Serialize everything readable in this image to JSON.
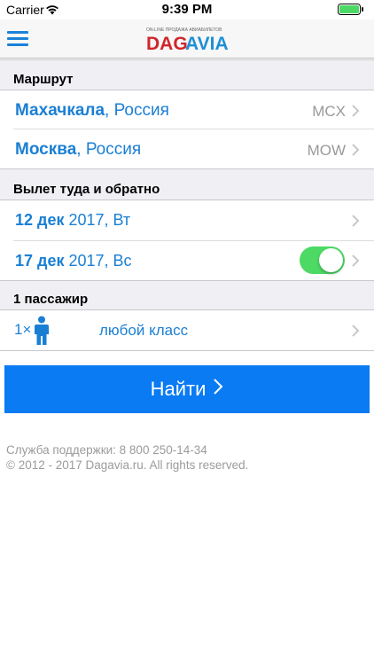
{
  "status_bar": {
    "carrier": "Carrier",
    "time": "9:39 PM"
  },
  "header": {
    "logo_top_text": "ON-LINE ПРОДАЖА АВИАБИЛЕТОВ",
    "logo_text_left": "DAG",
    "logo_text_right": "AVIA"
  },
  "route": {
    "title": "Маршрут",
    "from": {
      "city": "Махачкала",
      "country": ", Россия",
      "code": "MCX"
    },
    "to": {
      "city": "Москва",
      "country": ", Россия",
      "code": "MOW"
    }
  },
  "dates": {
    "title": "Вылет туда и обратно",
    "depart": {
      "day": "12 дек",
      "rest": " 2017, Вт"
    },
    "return": {
      "day": "17 дек",
      "rest": " 2017, Вс",
      "enabled": true
    }
  },
  "passengers": {
    "title": "1 пассажир",
    "count": "1×",
    "class": "любой класс"
  },
  "search_button": {
    "label": "Найти"
  },
  "footer": {
    "support": "Служба поддержки: 8 800 250-14-34",
    "copyright": "© 2012 - 2017 Dagavia.ru. All rights reserved."
  },
  "colors": {
    "accent": "#1a7fd4",
    "button": "#0a7bf3",
    "toggle_on": "#4cd964",
    "logo_red": "#d0262b",
    "logo_blue": "#1f8fd6"
  }
}
